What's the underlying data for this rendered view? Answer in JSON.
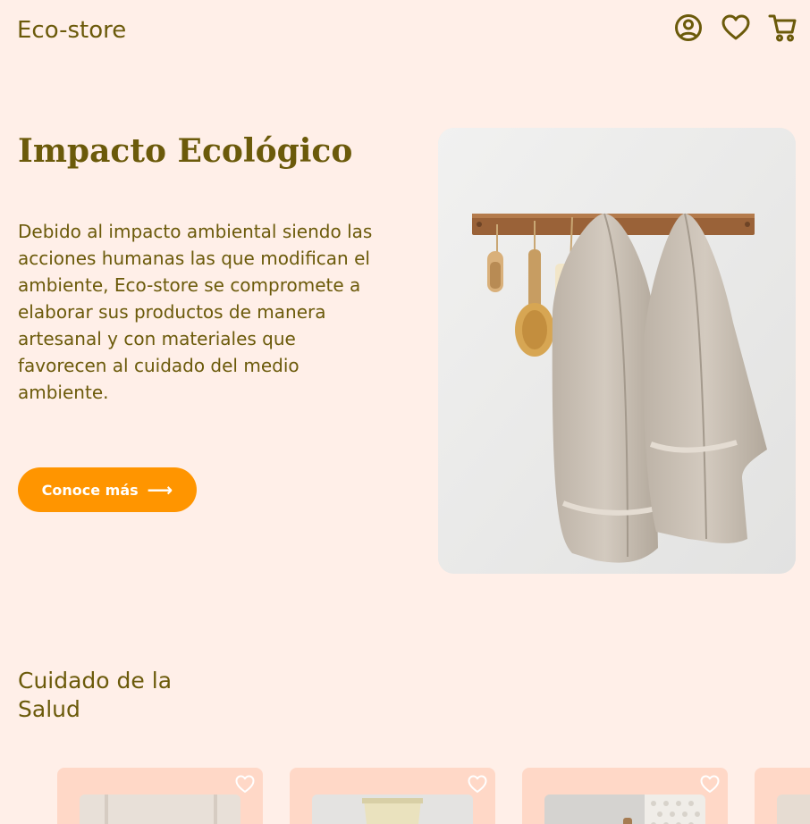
{
  "header": {
    "logo": "Eco-store",
    "icons": [
      "user-icon",
      "heart-icon",
      "cart-icon"
    ]
  },
  "hero": {
    "title": "Impacto Ecológico",
    "text": "Debido al impacto ambiental siendo las acciones humanas las que modifican el ambiente, Eco-store se compromete a elaborar sus productos de manera artesanal y con materiales que favorecen al cuidado del medio ambiente.",
    "cta_label": "Conoce más",
    "cta_icon": "arrow-right-icon"
  },
  "section": {
    "title": "Cuidado de la Salud"
  },
  "colors": {
    "background": "#FFEFE8",
    "text": "#6B5A0A",
    "accent": "#FF9500",
    "card": "#FFD8C7"
  }
}
